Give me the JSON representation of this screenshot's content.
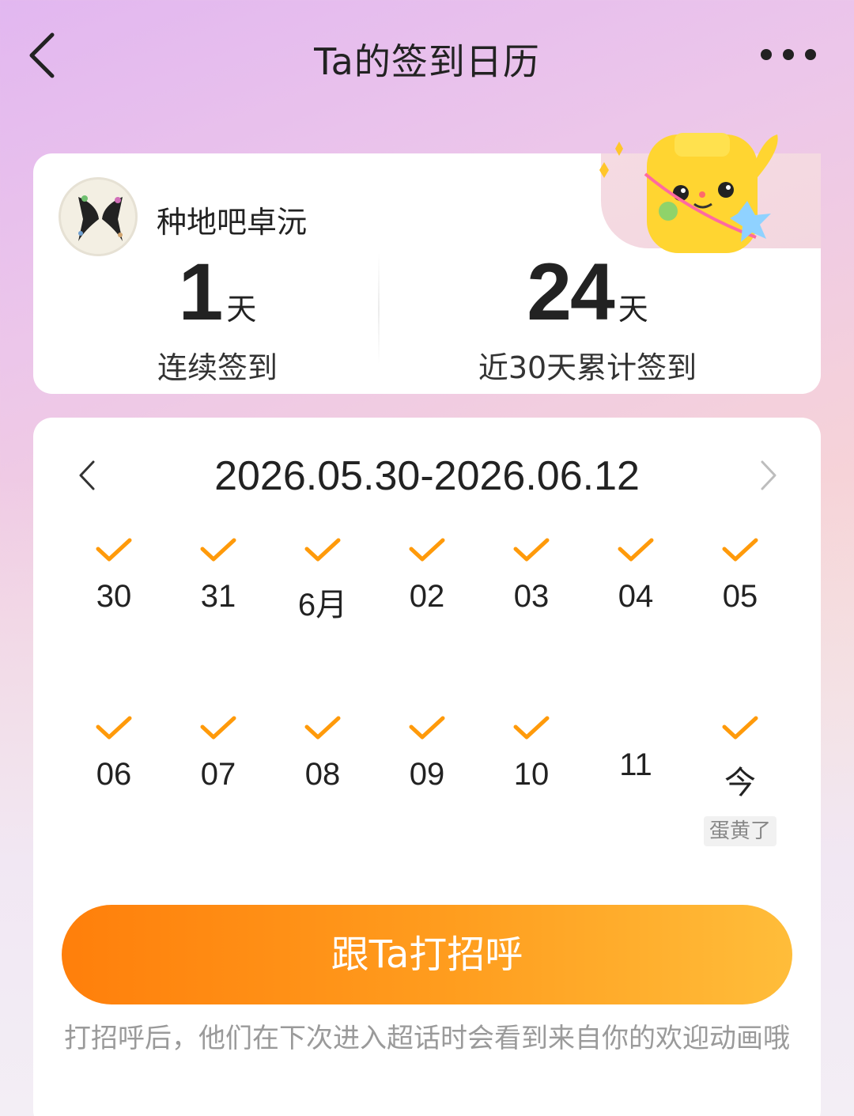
{
  "header": {
    "title": "Ta的签到日历"
  },
  "profile": {
    "username": "种地吧卓沅",
    "streak": {
      "value": "1",
      "unit": "天",
      "label": "连续签到"
    },
    "total": {
      "value": "24",
      "unit": "天",
      "label": "近30天累计签到"
    }
  },
  "calendar": {
    "range": "2026.05.30-2026.06.12",
    "row1": [
      {
        "label": "30",
        "checked": true
      },
      {
        "label": "31",
        "checked": true
      },
      {
        "label": "6月",
        "checked": true
      },
      {
        "label": "02",
        "checked": true
      },
      {
        "label": "03",
        "checked": true
      },
      {
        "label": "04",
        "checked": true
      },
      {
        "label": "05",
        "checked": true
      }
    ],
    "row2": [
      {
        "label": "06",
        "checked": true
      },
      {
        "label": "07",
        "checked": true
      },
      {
        "label": "08",
        "checked": true
      },
      {
        "label": "09",
        "checked": true
      },
      {
        "label": "10",
        "checked": true
      },
      {
        "label": "11",
        "checked": false
      },
      {
        "label": "今",
        "checked": true
      }
    ],
    "today_badge": "蛋黄了"
  },
  "cta": {
    "label": "跟Ta打招呼"
  },
  "hint": "打招呼后，他们在下次进入超话时会看到来自你的欢迎动画哦",
  "colors": {
    "accent": "#ff8a00",
    "check": "#ff9a0a"
  }
}
